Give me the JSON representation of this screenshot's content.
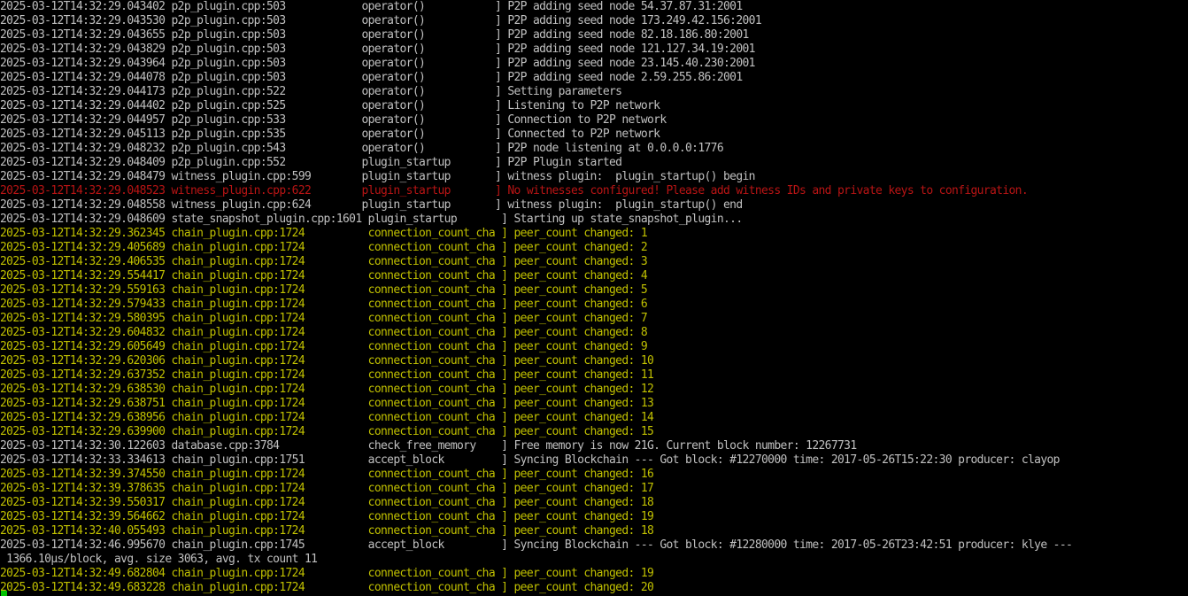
{
  "terminal": {
    "lines": [
      {
        "color": "w",
        "text": "2025-03-12T14:32:29.043402 p2p_plugin.cpp:503            operator()           ] P2P adding seed node 54.37.87.31:2001"
      },
      {
        "color": "w",
        "text": "2025-03-12T14:32:29.043530 p2p_plugin.cpp:503            operator()           ] P2P adding seed node 173.249.42.156:2001"
      },
      {
        "color": "w",
        "text": "2025-03-12T14:32:29.043655 p2p_plugin.cpp:503            operator()           ] P2P adding seed node 82.18.186.80:2001"
      },
      {
        "color": "w",
        "text": "2025-03-12T14:32:29.043829 p2p_plugin.cpp:503            operator()           ] P2P adding seed node 121.127.34.19:2001"
      },
      {
        "color": "w",
        "text": "2025-03-12T14:32:29.043964 p2p_plugin.cpp:503            operator()           ] P2P adding seed node 23.145.40.230:2001"
      },
      {
        "color": "w",
        "text": "2025-03-12T14:32:29.044078 p2p_plugin.cpp:503            operator()           ] P2P adding seed node 2.59.255.86:2001"
      },
      {
        "color": "w",
        "text": "2025-03-12T14:32:29.044173 p2p_plugin.cpp:522            operator()           ] Setting parameters"
      },
      {
        "color": "w",
        "text": "2025-03-12T14:32:29.044402 p2p_plugin.cpp:525            operator()           ] Listening to P2P network"
      },
      {
        "color": "w",
        "text": "2025-03-12T14:32:29.044957 p2p_plugin.cpp:533            operator()           ] Connection to P2P network"
      },
      {
        "color": "w",
        "text": "2025-03-12T14:32:29.045113 p2p_plugin.cpp:535            operator()           ] Connected to P2P network"
      },
      {
        "color": "w",
        "text": "2025-03-12T14:32:29.048232 p2p_plugin.cpp:543            operator()           ] P2P node listening at 0.0.0.0:1776"
      },
      {
        "color": "w",
        "text": "2025-03-12T14:32:29.048409 p2p_plugin.cpp:552            plugin_startup       ] P2P Plugin started"
      },
      {
        "color": "w",
        "text": "2025-03-12T14:32:29.048479 witness_plugin.cpp:599        plugin_startup       ] witness plugin:  plugin_startup() begin"
      },
      {
        "color": "r",
        "text": "2025-03-12T14:32:29.048523 witness_plugin.cpp:622        plugin_startup       ] No witnesses configured! Please add witness IDs and private keys to configuration."
      },
      {
        "color": "w",
        "text": "2025-03-12T14:32:29.048558 witness_plugin.cpp:624        plugin_startup       ] witness plugin:  plugin_startup() end"
      },
      {
        "color": "w",
        "text": "2025-03-12T14:32:29.048609 state_snapshot_plugin.cpp:1601 plugin_startup       ] Starting up state_snapshot_plugin..."
      },
      {
        "color": "y",
        "text": "2025-03-12T14:32:29.362345 chain_plugin.cpp:1724          connection_count_cha ] peer_count changed: 1"
      },
      {
        "color": "y",
        "text": "2025-03-12T14:32:29.405689 chain_plugin.cpp:1724          connection_count_cha ] peer_count changed: 2"
      },
      {
        "color": "y",
        "text": "2025-03-12T14:32:29.406535 chain_plugin.cpp:1724          connection_count_cha ] peer_count changed: 3"
      },
      {
        "color": "y",
        "text": "2025-03-12T14:32:29.554417 chain_plugin.cpp:1724          connection_count_cha ] peer_count changed: 4"
      },
      {
        "color": "y",
        "text": "2025-03-12T14:32:29.559163 chain_plugin.cpp:1724          connection_count_cha ] peer_count changed: 5"
      },
      {
        "color": "y",
        "text": "2025-03-12T14:32:29.579433 chain_plugin.cpp:1724          connection_count_cha ] peer_count changed: 6"
      },
      {
        "color": "y",
        "text": "2025-03-12T14:32:29.580395 chain_plugin.cpp:1724          connection_count_cha ] peer_count changed: 7"
      },
      {
        "color": "y",
        "text": "2025-03-12T14:32:29.604832 chain_plugin.cpp:1724          connection_count_cha ] peer_count changed: 8"
      },
      {
        "color": "y",
        "text": "2025-03-12T14:32:29.605649 chain_plugin.cpp:1724          connection_count_cha ] peer_count changed: 9"
      },
      {
        "color": "y",
        "text": "2025-03-12T14:32:29.620306 chain_plugin.cpp:1724          connection_count_cha ] peer_count changed: 10"
      },
      {
        "color": "y",
        "text": "2025-03-12T14:32:29.637352 chain_plugin.cpp:1724          connection_count_cha ] peer_count changed: 11"
      },
      {
        "color": "y",
        "text": "2025-03-12T14:32:29.638530 chain_plugin.cpp:1724          connection_count_cha ] peer_count changed: 12"
      },
      {
        "color": "y",
        "text": "2025-03-12T14:32:29.638751 chain_plugin.cpp:1724          connection_count_cha ] peer_count changed: 13"
      },
      {
        "color": "y",
        "text": "2025-03-12T14:32:29.638956 chain_plugin.cpp:1724          connection_count_cha ] peer_count changed: 14"
      },
      {
        "color": "y",
        "text": "2025-03-12T14:32:29.639900 chain_plugin.cpp:1724          connection_count_cha ] peer_count changed: 15"
      },
      {
        "color": "w",
        "text": "2025-03-12T14:32:30.122603 database.cpp:3784              check_free_memory    ] Free memory is now 21G. Current block number: 12267731"
      },
      {
        "color": "w",
        "text": "2025-03-12T14:32:33.334613 chain_plugin.cpp:1751          accept_block         ] Syncing Blockchain --- Got block: #12270000 time: 2017-05-26T15:22:30 producer: clayop"
      },
      {
        "color": "y",
        "text": "2025-03-12T14:32:39.374550 chain_plugin.cpp:1724          connection_count_cha ] peer_count changed: 16"
      },
      {
        "color": "y",
        "text": "2025-03-12T14:32:39.378635 chain_plugin.cpp:1724          connection_count_cha ] peer_count changed: 17"
      },
      {
        "color": "y",
        "text": "2025-03-12T14:32:39.550317 chain_plugin.cpp:1724          connection_count_cha ] peer_count changed: 18"
      },
      {
        "color": "y",
        "text": "2025-03-12T14:32:39.564662 chain_plugin.cpp:1724          connection_count_cha ] peer_count changed: 19"
      },
      {
        "color": "y",
        "text": "2025-03-12T14:32:40.055493 chain_plugin.cpp:1724          connection_count_cha ] peer_count changed: 18"
      },
      {
        "color": "w",
        "text": "2025-03-12T14:32:46.995670 chain_plugin.cpp:1745          accept_block         ] Syncing Blockchain --- Got block: #12280000 time: 2017-05-26T23:42:51 producer: klye ---"
      },
      {
        "color": "w",
        "text": " 1366.10µs/block, avg. size 3063, avg. tx count 11"
      },
      {
        "color": "y",
        "text": "2025-03-12T14:32:49.682804 chain_plugin.cpp:1724          connection_count_cha ] peer_count changed: 19"
      },
      {
        "color": "y",
        "text": "2025-03-12T14:32:49.683228 chain_plugin.cpp:1724          connection_count_cha ] peer_count changed: 20"
      }
    ]
  },
  "cursor": {
    "icon": "block-cursor",
    "color": "#00c000"
  }
}
